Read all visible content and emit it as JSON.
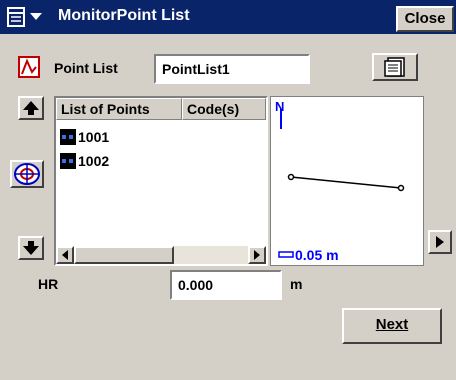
{
  "titlebar": {
    "title": "MonitorPoint List",
    "close_label": "Close"
  },
  "point_list": {
    "label": "Point List",
    "value": "PointList1"
  },
  "list": {
    "headers": [
      "List of Points",
      "Code(s)"
    ],
    "items": [
      {
        "name": "1001"
      },
      {
        "name": "1002"
      }
    ]
  },
  "map": {
    "north_label": "N",
    "scale_label": "0.05 m"
  },
  "hr": {
    "label": "HR",
    "value": "0.000",
    "unit": "m"
  },
  "actions": {
    "next_label": "Next"
  },
  "colors": {
    "titlebar": "#0a246a",
    "face": "#d4d0c8",
    "accent_blue": "#0000ff"
  }
}
